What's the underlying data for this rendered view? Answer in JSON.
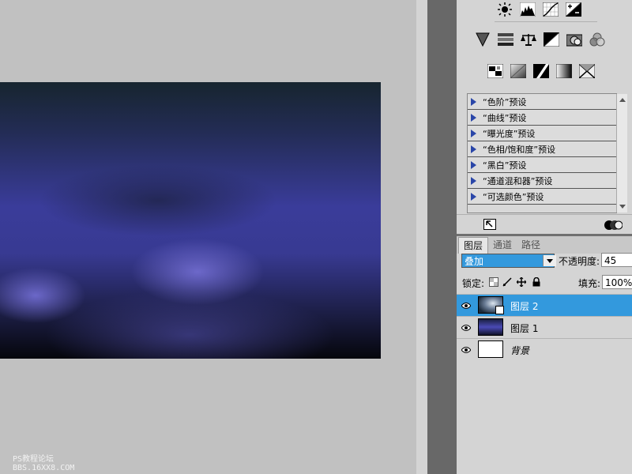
{
  "watermark": {
    "line1": "PS教程论坛",
    "line2": "BBS.16XX8.COM"
  },
  "adjustments": {
    "icon_rows": [
      [
        "brightness-contrast-icon",
        "levels-icon",
        "curves-icon",
        "exposure-icon"
      ],
      [
        "vibrance-icon",
        "hue-saturation-icon",
        "color-balance-icon",
        "black-white-icon",
        "photo-filter-icon",
        "channel-mixer-icon"
      ],
      [
        "invert-icon",
        "posterize-icon",
        "threshold-icon",
        "gradient-map-icon",
        "selective-color-icon"
      ]
    ],
    "presets": [
      "“色阶”预设",
      "“曲线”预设",
      "“曝光度”预设",
      "“色相/饱和度”预设",
      "“黑白”预设",
      "“通道混和器”预设",
      "“可选颜色”预设"
    ]
  },
  "layers_panel": {
    "tabs": [
      "图层",
      "通道",
      "路径"
    ],
    "blend_mode": "叠加",
    "opacity_label": "不透明度:",
    "opacity_value": "45",
    "lock_label": "锁定:",
    "fill_label": "填充:",
    "fill_value": "100%",
    "layers": [
      {
        "name": "图层 2",
        "selected": true
      },
      {
        "name": "图层 1",
        "selected": false
      },
      {
        "name": "背景",
        "selected": false
      }
    ]
  },
  "colors": {
    "selection": "#3399dd",
    "accent_triangle": "#2a46a8"
  }
}
